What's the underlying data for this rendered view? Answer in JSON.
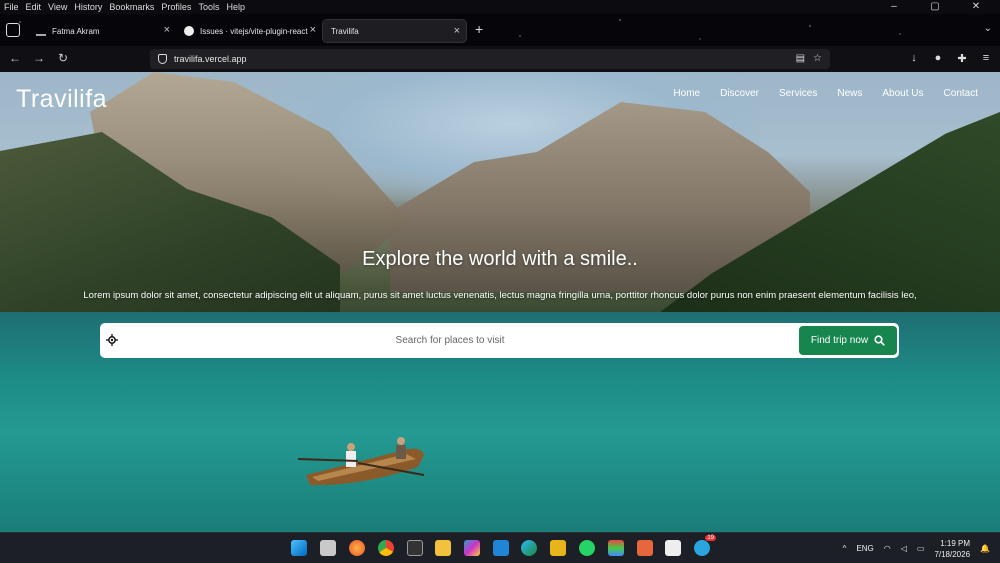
{
  "menu": [
    "File",
    "Edit",
    "View",
    "History",
    "Bookmarks",
    "Profiles",
    "Tools",
    "Help"
  ],
  "window_controls": [
    "–",
    "▢",
    "✕"
  ],
  "tabs": [
    {
      "label": "Fatma Akram"
    },
    {
      "label": "Issues · vitejs/vite-plugin-react"
    },
    {
      "label": "Travilifa"
    }
  ],
  "address": {
    "url": "travilifa.vercel.app"
  },
  "site": {
    "brand": "Travilifa",
    "nav": [
      "Home",
      "Discover",
      "Services",
      "News",
      "About Us",
      "Contact"
    ],
    "headline": "Explore the world with a smile..",
    "lede": "Lorem ipsum dolor sit amet, consectetur adipiscing elit ut aliquam, purus sit amet luctus venenatis, lectus magna fringilla urna, porttitor rhoncus dolor purus non enim praesent elementum facilisis leo,",
    "search_placeholder": "Search for places to visit",
    "search_button": "Find trip now"
  },
  "taskbar": {
    "lang": "ENG",
    "time": "1:19 PM",
    "date": "7/18/2026",
    "badge": "19"
  },
  "colors": {
    "accent": "#17854e",
    "taskbar": "#1c1f26",
    "chrome": "#101014"
  }
}
